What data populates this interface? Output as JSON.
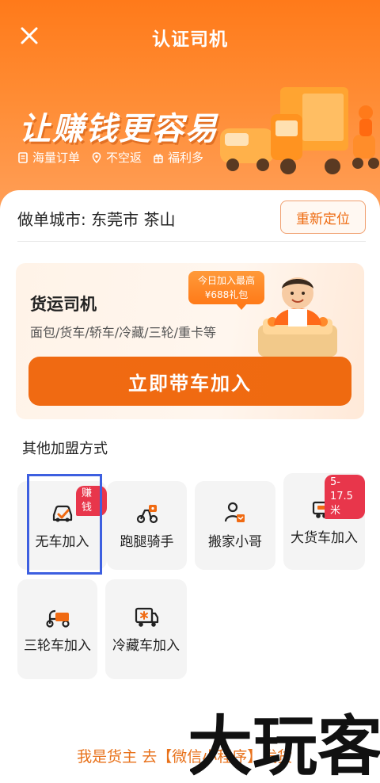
{
  "header": {
    "title": "认证司机",
    "slogan": "让赚钱更容易",
    "perks": [
      "海量订单",
      "不空返",
      "福利多"
    ]
  },
  "city": {
    "text": "做单城市: 东莞市 茶山",
    "relocate_label": "重新定位"
  },
  "driver_card": {
    "title": "货运司机",
    "subtitle": "面包/货车/轿车/冷藏/三轮/重卡等",
    "bonus_line1": "今日加入最高",
    "bonus_line2": "¥688礼包",
    "join_label": "立即带车加入"
  },
  "other": {
    "title": "其他加盟方式",
    "tiles": [
      {
        "label": "无车加入",
        "badge": "赚钱",
        "icon": "car-check-icon"
      },
      {
        "label": "跑腿骑手",
        "icon": "rider-icon"
      },
      {
        "label": "搬家小哥",
        "icon": "mover-icon"
      },
      {
        "label": "大货车加入",
        "badge": "5-17.5米",
        "icon": "big-truck-icon"
      },
      {
        "label": "三轮车加入",
        "icon": "tricycle-icon"
      },
      {
        "label": "冷藏车加入",
        "icon": "refrigerated-truck-icon"
      }
    ]
  },
  "footer": {
    "link": "我是货主 去【微信小程序】发货 ›"
  },
  "watermark": {
    "text": "大玩客"
  },
  "colors": {
    "brand": "#f06a12",
    "badge": "#e8364b",
    "highlight": "#3d5fe0"
  }
}
